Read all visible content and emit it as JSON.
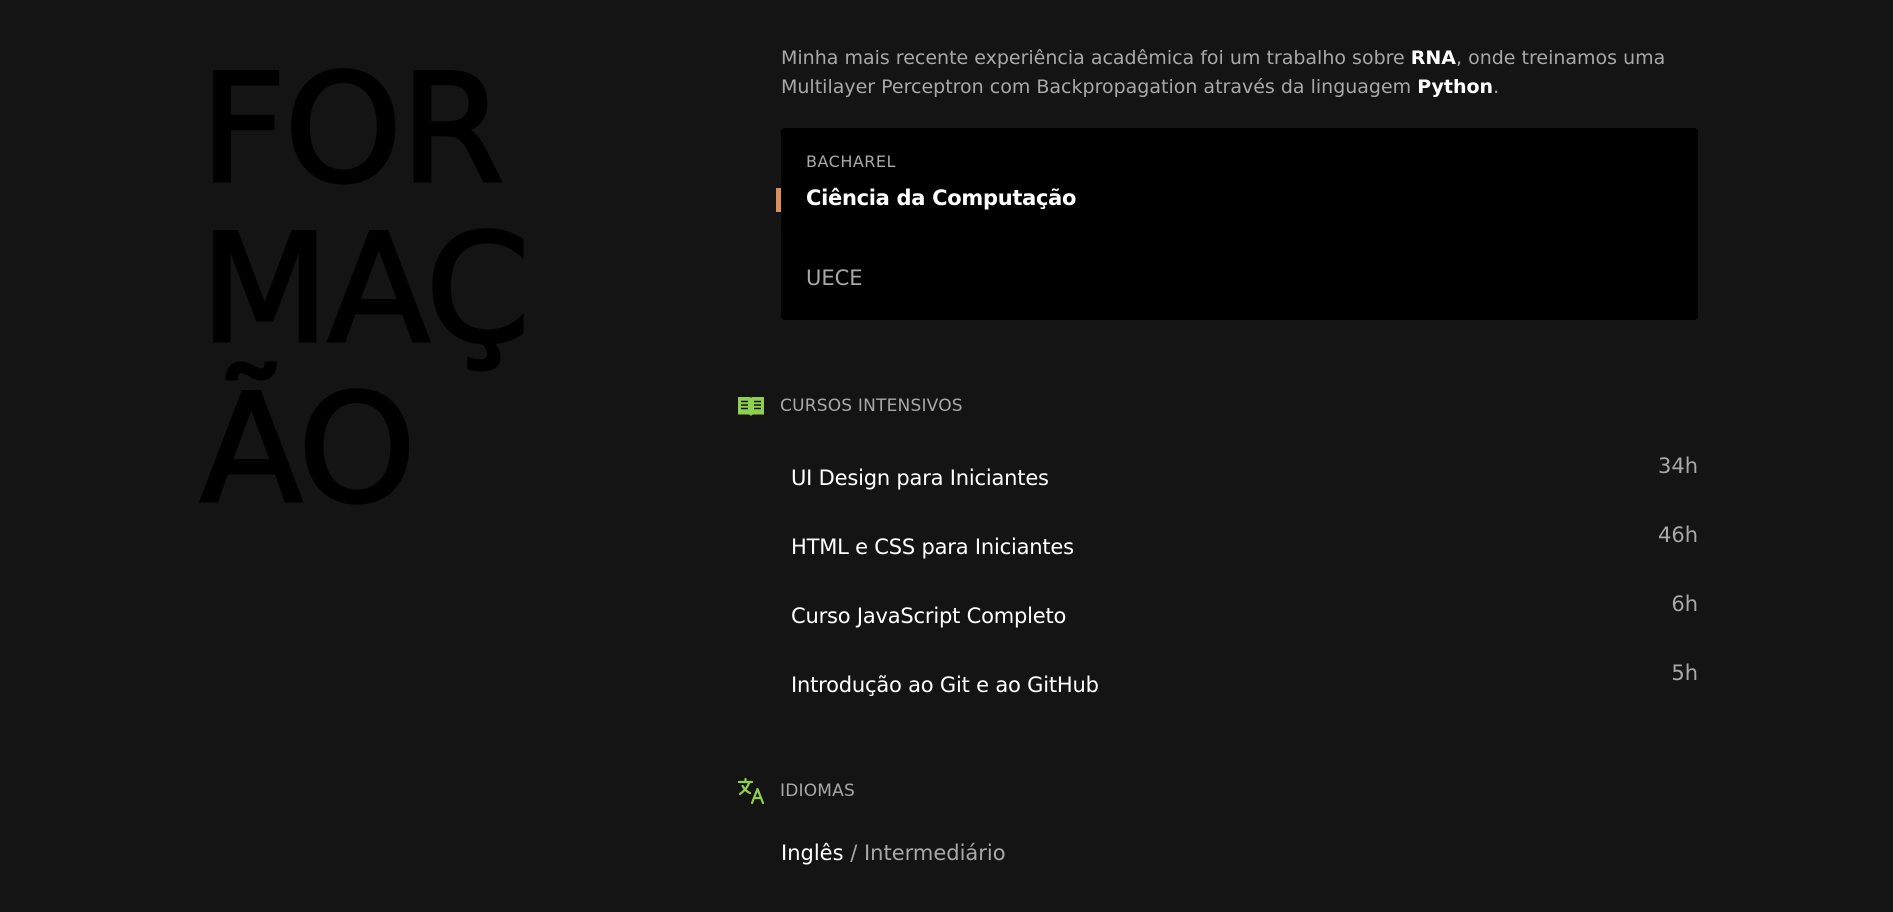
{
  "hero": {
    "title_lines": [
      "FOR",
      "MAÇ",
      "ÃO"
    ]
  },
  "intro": {
    "text_before_rna": "Minha mais recente experiência acadêmica foi um trabalho sobre ",
    "rna": "RNA",
    "text_after_rna": ", onde treinamos uma Multilayer Perceptron com Backpropagation através da linguagem ",
    "python": "Python",
    "text_end": "."
  },
  "degree": {
    "level": "BACHAREL",
    "name": "Ciência da Computação",
    "school": "UECE",
    "accent_color": "#d8905c"
  },
  "courses": {
    "heading": "CURSOS INTENSIVOS",
    "icon": "open-book-icon",
    "items": [
      {
        "name": "UI Design para Iniciantes",
        "hours": "34h"
      },
      {
        "name": "HTML e CSS para Iniciantes",
        "hours": "46h"
      },
      {
        "name": "Curso JavaScript Completo",
        "hours": "6h"
      },
      {
        "name": "Introdução ao Git e ao GitHub",
        "hours": "5h"
      }
    ]
  },
  "languages": {
    "heading": "IDIOMAS",
    "icon": "translate-icon",
    "items": [
      {
        "name": "Inglês",
        "separator": " / ",
        "level": "Intermediário"
      }
    ]
  },
  "colors": {
    "background": "#141414",
    "card": "#000000",
    "icon_green": "#8fd14f",
    "muted_text": "#a8a8a8"
  }
}
